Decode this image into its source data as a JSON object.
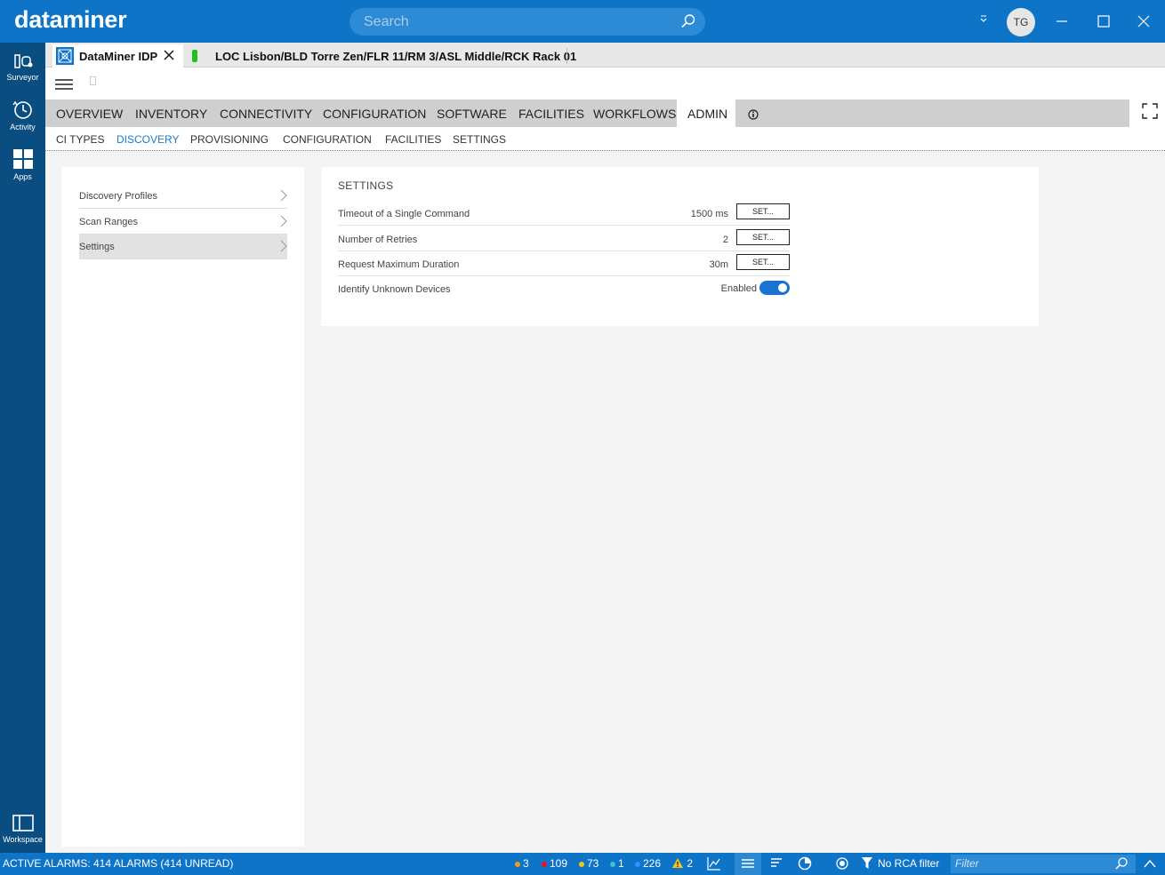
{
  "app": {
    "logo": "dataminer",
    "user_initials": "TG"
  },
  "search": {
    "placeholder": "Search"
  },
  "rail": {
    "items": [
      {
        "label": "Surveyor",
        "icon": "surveyor-icon"
      },
      {
        "label": "Activity",
        "icon": "activity-icon"
      },
      {
        "label": "Apps",
        "icon": "apps-icon"
      }
    ],
    "workspace": {
      "label": "Workspace",
      "icon": "workspace-icon"
    }
  },
  "tabs": [
    {
      "title": "DataMiner IDP",
      "active": true
    },
    {
      "title": "LOC Lisbon/BLD Torre Zen/FLR 11/RM 3/ASL Middle/RCK Rack 01",
      "status_color": "#21c021"
    }
  ],
  "nav": {
    "items": [
      "OVERVIEW",
      "INVENTORY",
      "CONNECTIVITY",
      "CONFIGURATION",
      "SOFTWARE",
      "FACILITIES",
      "WORKFLOWS",
      "ADMIN"
    ],
    "active": "ADMIN"
  },
  "subnav": {
    "items": [
      "CI TYPES",
      "DISCOVERY",
      "PROVISIONING",
      "CONFIGURATION",
      "FACILITIES",
      "SETTINGS"
    ],
    "active": "DISCOVERY"
  },
  "left_panel": {
    "items": [
      "Discovery Profiles",
      "Scan Ranges",
      "Settings"
    ],
    "selected": "Settings"
  },
  "settings": {
    "title": "SETTINGS",
    "rows": [
      {
        "label": "Timeout of a Single Command",
        "value": "1500 ms",
        "button": "SET..."
      },
      {
        "label": "Number of Retries",
        "value": "2",
        "button": "SET..."
      },
      {
        "label": "Request Maximum Duration",
        "value": "30m",
        "button": "SET..."
      }
    ],
    "toggle_row": {
      "label": "Identify Unknown Devices",
      "state_label": "Enabled",
      "enabled": true
    }
  },
  "statusbar": {
    "alarms_text": "ACTIVE ALARMS: 414 ALARMS (414 UNREAD)",
    "counts": [
      {
        "value": "3",
        "color": "#f39c12"
      },
      {
        "value": "109",
        "color": "#e81123"
      },
      {
        "value": "73",
        "color": "#f5c518"
      },
      {
        "value": "1",
        "color": "#3fc1c9"
      },
      {
        "value": "226",
        "color": "#3c8dff"
      }
    ],
    "warning_count": "2",
    "rca_filter": "No RCA filter",
    "filter_placeholder": "Filter"
  },
  "colors": {
    "accent": "#0d74c8",
    "rail": "#0a4d80",
    "active_link": "#1a7dc9"
  }
}
